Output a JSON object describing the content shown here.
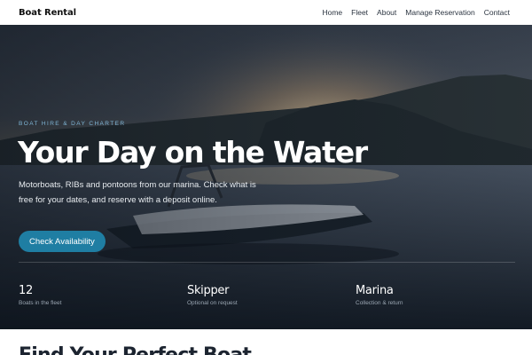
{
  "nav": {
    "brand": "Boat Rental",
    "links": [
      "Home",
      "Fleet",
      "About",
      "Manage Reservation",
      "Contact"
    ]
  },
  "hero": {
    "eyebrow": "BOAT HIRE & DAY CHARTER",
    "title": "Your Day on the Water",
    "lead": "Motorboats, RIBs and pontoons from our marina. Check what is free for your dates, and reserve with a deposit online.",
    "cta": "Check Availability",
    "stats": [
      {
        "value": "12",
        "caption": "Boats in the fleet"
      },
      {
        "value": "Skipper",
        "caption": "Optional on request"
      },
      {
        "value": "Marina",
        "caption": "Collection & return"
      }
    ]
  },
  "next_section": {
    "title": "Find Your Perfect Boat"
  },
  "colors": {
    "accent": "#1f7ea3",
    "eyebrow": "#7fb6d6",
    "nav_bg": "#ffffff"
  }
}
